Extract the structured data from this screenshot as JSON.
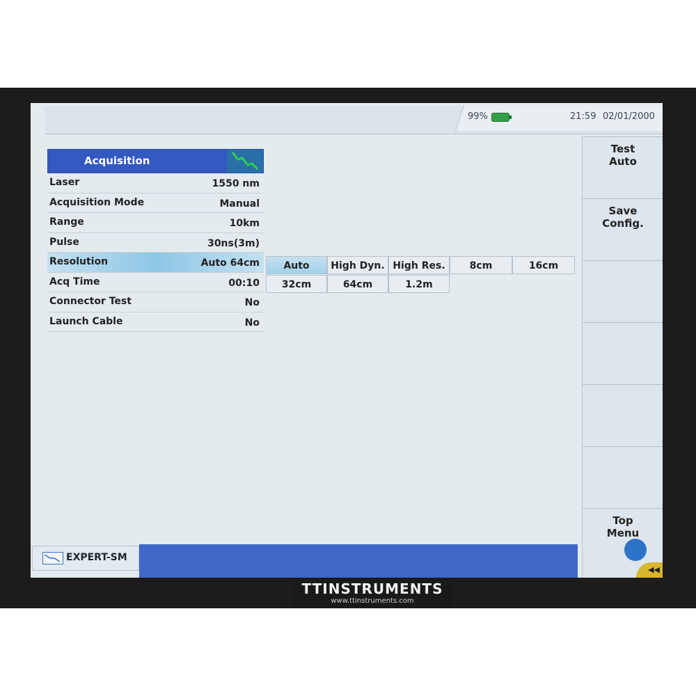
{
  "status": {
    "battery": "99%",
    "time": "21:59",
    "date": "02/01/2000"
  },
  "panel": {
    "title": "Acquisition",
    "icon": "trace-icon",
    "rows": [
      {
        "label": "Laser",
        "value": "1550 nm"
      },
      {
        "label": "Acquisition Mode",
        "value": "Manual"
      },
      {
        "label": "Range",
        "value": "10km"
      },
      {
        "label": "Pulse",
        "value": "30ns(3m)"
      },
      {
        "label": "Resolution",
        "value": "Auto 64cm"
      },
      {
        "label": "Acq Time",
        "value": "00:10"
      },
      {
        "label": "Connector Test",
        "value": "No"
      },
      {
        "label": "Launch Cable",
        "value": "No"
      }
    ]
  },
  "resolution_options": [
    "Auto",
    "High Dyn.",
    "High Res.",
    "8cm",
    "16cm",
    "32cm",
    "64cm",
    "1.2m"
  ],
  "softkeys": {
    "test_auto": {
      "line1": "Test",
      "line2": "Auto"
    },
    "save_config": {
      "line1": "Save",
      "line2": "Config."
    },
    "top_menu": {
      "line1": "Top",
      "line2": "Menu"
    }
  },
  "mode": {
    "label": "EXPERT-SM"
  },
  "brand": {
    "name": "TTINSTRUMENTS",
    "url": "www.ttinstruments.com"
  },
  "colors": {
    "header_blue": "#3358bf",
    "highlight": "#a2d2ea",
    "battery": "#32a046"
  }
}
